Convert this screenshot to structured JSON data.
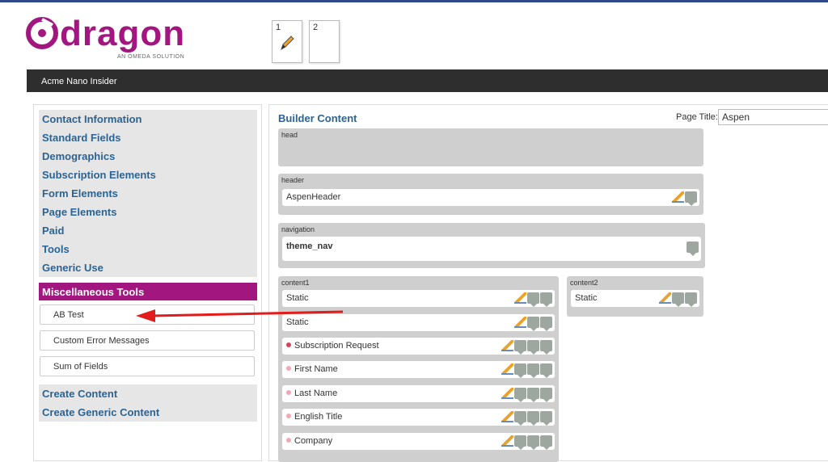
{
  "logo": {
    "word": "dragon",
    "tagline": "AN OMEDA SOLUTION"
  },
  "page_tabs": [
    {
      "number": "1"
    },
    {
      "number": "2"
    }
  ],
  "titlebar": "Acme Nano Insider",
  "sidebar": {
    "items": [
      "Contact Information",
      "Standard Fields",
      "Demographics",
      "Subscription Elements",
      "Form Elements",
      "Page Elements",
      "Paid",
      "Tools",
      "Generic Use"
    ],
    "misc_header": "Miscellaneous Tools",
    "misc_items": [
      "AB Test",
      "Custom Error Messages",
      "Sum of Fields"
    ],
    "bottom_items": [
      "Create Content",
      "Create Generic Content"
    ]
  },
  "builder": {
    "title": "Builder Content",
    "page_title_label": "Page Title:",
    "page_title_value": "Aspen",
    "regions": {
      "head": "head",
      "header": "header",
      "navigation": "navigation",
      "content1": "content1",
      "content2": "content2"
    },
    "header_row": "AspenHeader",
    "navigation_row": "theme_nav",
    "content1_rows": [
      {
        "text": "Static"
      },
      {
        "text": "Static"
      },
      {
        "text": "Subscription Request"
      },
      {
        "text": "First Name"
      },
      {
        "text": "Last Name"
      },
      {
        "text": "English Title"
      },
      {
        "text": "Company"
      }
    ],
    "content2_rows": [
      {
        "text": "Static"
      }
    ]
  },
  "colors": {
    "brand": "#a1167f",
    "link": "#2a6496",
    "titlebar": "#2e2e2e",
    "arrow": "#e31b1b",
    "required_dot": "#d9435a",
    "optional_dot": "#f2a7b3"
  }
}
